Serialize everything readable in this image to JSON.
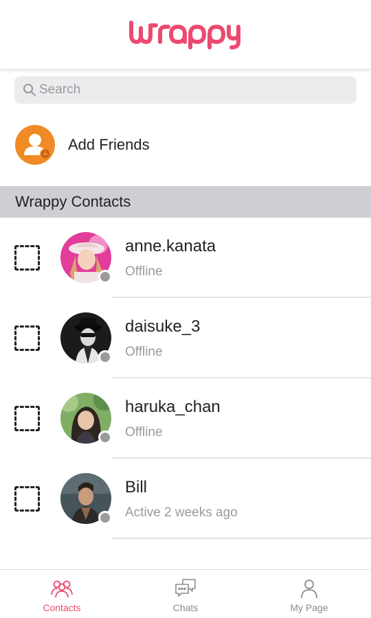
{
  "app": {
    "logo_text": "Wrappy",
    "brand_color": "#ec4a6f"
  },
  "search": {
    "placeholder": "Search"
  },
  "add_friends": {
    "label": "Add Friends",
    "icon": "add-user-icon",
    "color": "#f08a24"
  },
  "section": {
    "title": "Wrappy Contacts"
  },
  "contacts": [
    {
      "name": "anne.kanata",
      "status": "Offline",
      "avatar": "photo"
    },
    {
      "name": "daisuke_3",
      "status": "Offline",
      "avatar": "photo"
    },
    {
      "name": "haruka_chan",
      "status": "Offline",
      "avatar": "photo"
    },
    {
      "name": "Bill",
      "status": "Active 2 weeks ago",
      "avatar": "photo"
    }
  ],
  "status_dot_color": "#9a9a9a",
  "nav": {
    "items": [
      {
        "label": "Contacts",
        "icon": "contacts-icon",
        "active": true
      },
      {
        "label": "Chats",
        "icon": "chats-icon",
        "active": false
      },
      {
        "label": "My Page",
        "icon": "person-icon",
        "active": false
      }
    ],
    "active_color": "#ec4a6f",
    "inactive_color": "#8a8a8e"
  }
}
